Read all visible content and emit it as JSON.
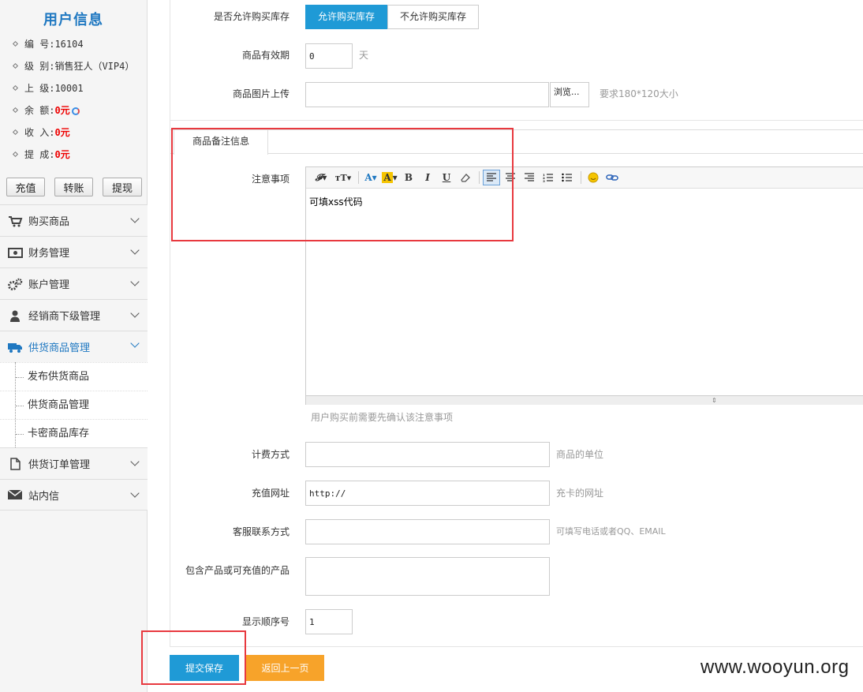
{
  "sidebar": {
    "title": "用户信息",
    "info": [
      {
        "label": "编  号:",
        "value": "16104",
        "red": false
      },
      {
        "label": "级  别:",
        "value": "销售狂人（VIP4）",
        "red": false
      },
      {
        "label": "上  级:",
        "value": "10001",
        "red": false
      },
      {
        "label": "余  额:",
        "value": "0元",
        "red": true
      },
      {
        "label": "收  入:",
        "value": "0元",
        "red": true
      },
      {
        "label": "提  成:",
        "value": "0元",
        "red": true
      }
    ],
    "buttons": {
      "recharge": "充值",
      "transfer": "转账",
      "withdraw": "提现"
    },
    "menu": [
      {
        "label": "购买商品",
        "icon": "cart-icon"
      },
      {
        "label": "财务管理",
        "icon": "money-icon"
      },
      {
        "label": "账户管理",
        "icon": "gears-icon"
      },
      {
        "label": "经销商下级管理",
        "icon": "user-icon"
      },
      {
        "label": "供货商品管理",
        "icon": "truck-icon"
      },
      {
        "label": "供货订单管理",
        "icon": "document-icon"
      },
      {
        "label": "站内信",
        "icon": "envelope-icon"
      }
    ],
    "submenu": [
      "发布供货商品",
      "供货商品管理",
      "卡密商品库存"
    ]
  },
  "form": {
    "stock_label": "是否允许购买库存",
    "stock_on": "允许购买库存",
    "stock_off": "不允许购买库存",
    "validity_label": "商品有效期",
    "validity_value": "0",
    "validity_unit": "天",
    "image_label": "商品图片上传",
    "browse": "浏览...",
    "image_hint": "要求180*120大小",
    "tab_label": "商品备注信息",
    "notes_label": "注意事项",
    "editor_content": "可填xss代码",
    "notes_hint": "用户购买前需要先确认该注意事项",
    "billing_label": "计费方式",
    "billing_hint": "商品的单位",
    "url_label": "充值网址",
    "url_value": "http://",
    "url_hint": "充卡的网址",
    "contact_label": "客服联系方式",
    "contact_hint": "可填写电话或者QQ、EMAIL",
    "products_label": "包含产品或可充值的产品",
    "order_label": "显示顺序号",
    "order_value": "1",
    "save": "提交保存",
    "back": "返回上一页"
  },
  "watermark": "www.wooyun.org",
  "colors": {
    "accent": "#1f9ad6",
    "orange": "#f7a32a",
    "highlight": "#e8393f"
  }
}
